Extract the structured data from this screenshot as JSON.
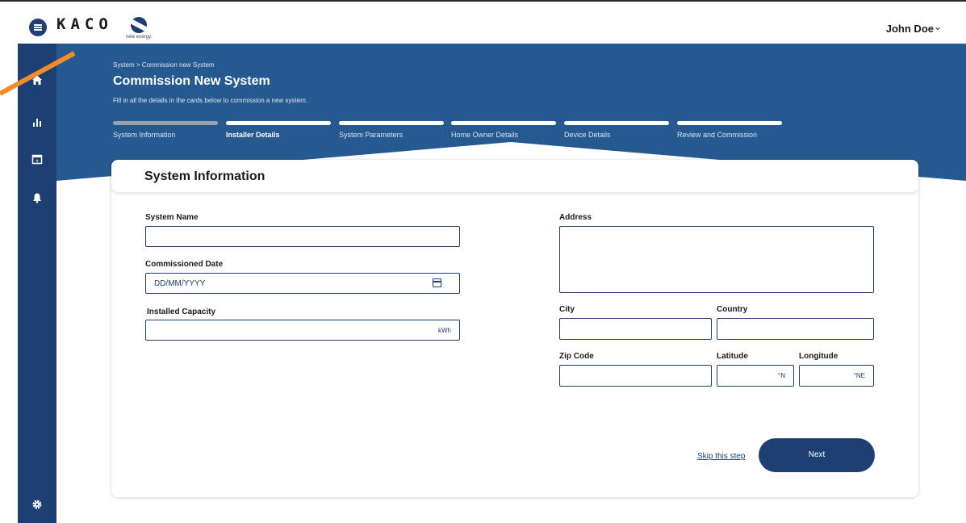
{
  "header": {
    "logo_text": "KACO",
    "logo_tagline": "new energy.",
    "user_name": "John Doe",
    "user_chevron": "⌄"
  },
  "sidebar": {
    "items": [
      {
        "icon": "home-icon",
        "glyph": "⌂"
      },
      {
        "icon": "chart-icon",
        "glyph": "▂▆█"
      },
      {
        "icon": "calendar-icon",
        "glyph": "▣"
      },
      {
        "icon": "bell-icon",
        "glyph": "🔔"
      }
    ],
    "settings_icon": "gear-icon"
  },
  "banner": {
    "breadcrumb": "System > Commission new System",
    "title": "Commission New System",
    "subtitle": "Fill in all the details in the cards below to commission a new system."
  },
  "steps": [
    {
      "label": "System Information",
      "state": "done"
    },
    {
      "label": "Installer Details",
      "state": "active"
    },
    {
      "label": "System Parameters",
      "state": "pending"
    },
    {
      "label": "Home Owner Details",
      "state": "pending"
    },
    {
      "label": "Device Details",
      "state": "pending"
    },
    {
      "label": "Review and Commission",
      "state": "pending"
    }
  ],
  "card": {
    "title": "System Information",
    "fields": {
      "system_name": {
        "label": "System Name",
        "value": ""
      },
      "commissioned_date": {
        "label": "Commissioned Date",
        "placeholder": "DD/MM/YYYY"
      },
      "installed_capacity": {
        "label": "Installed Capacity",
        "unit": "kWh"
      },
      "address": {
        "label": "Address",
        "value": ""
      },
      "city": {
        "label": "City",
        "value": ""
      },
      "country": {
        "label": "Country",
        "value": ""
      },
      "zip_code": {
        "label": "Zip Code",
        "value": ""
      },
      "latitude": {
        "label": "Latitude",
        "unit": "°N"
      },
      "longitude": {
        "label": "Longitude",
        "unit": "°NE"
      }
    },
    "skip_label": "Skip this step",
    "next_label": "Next"
  },
  "colors": {
    "primary": "#1e3f72",
    "banner": "#26598f",
    "annotation_arrow": "#f28c28"
  }
}
